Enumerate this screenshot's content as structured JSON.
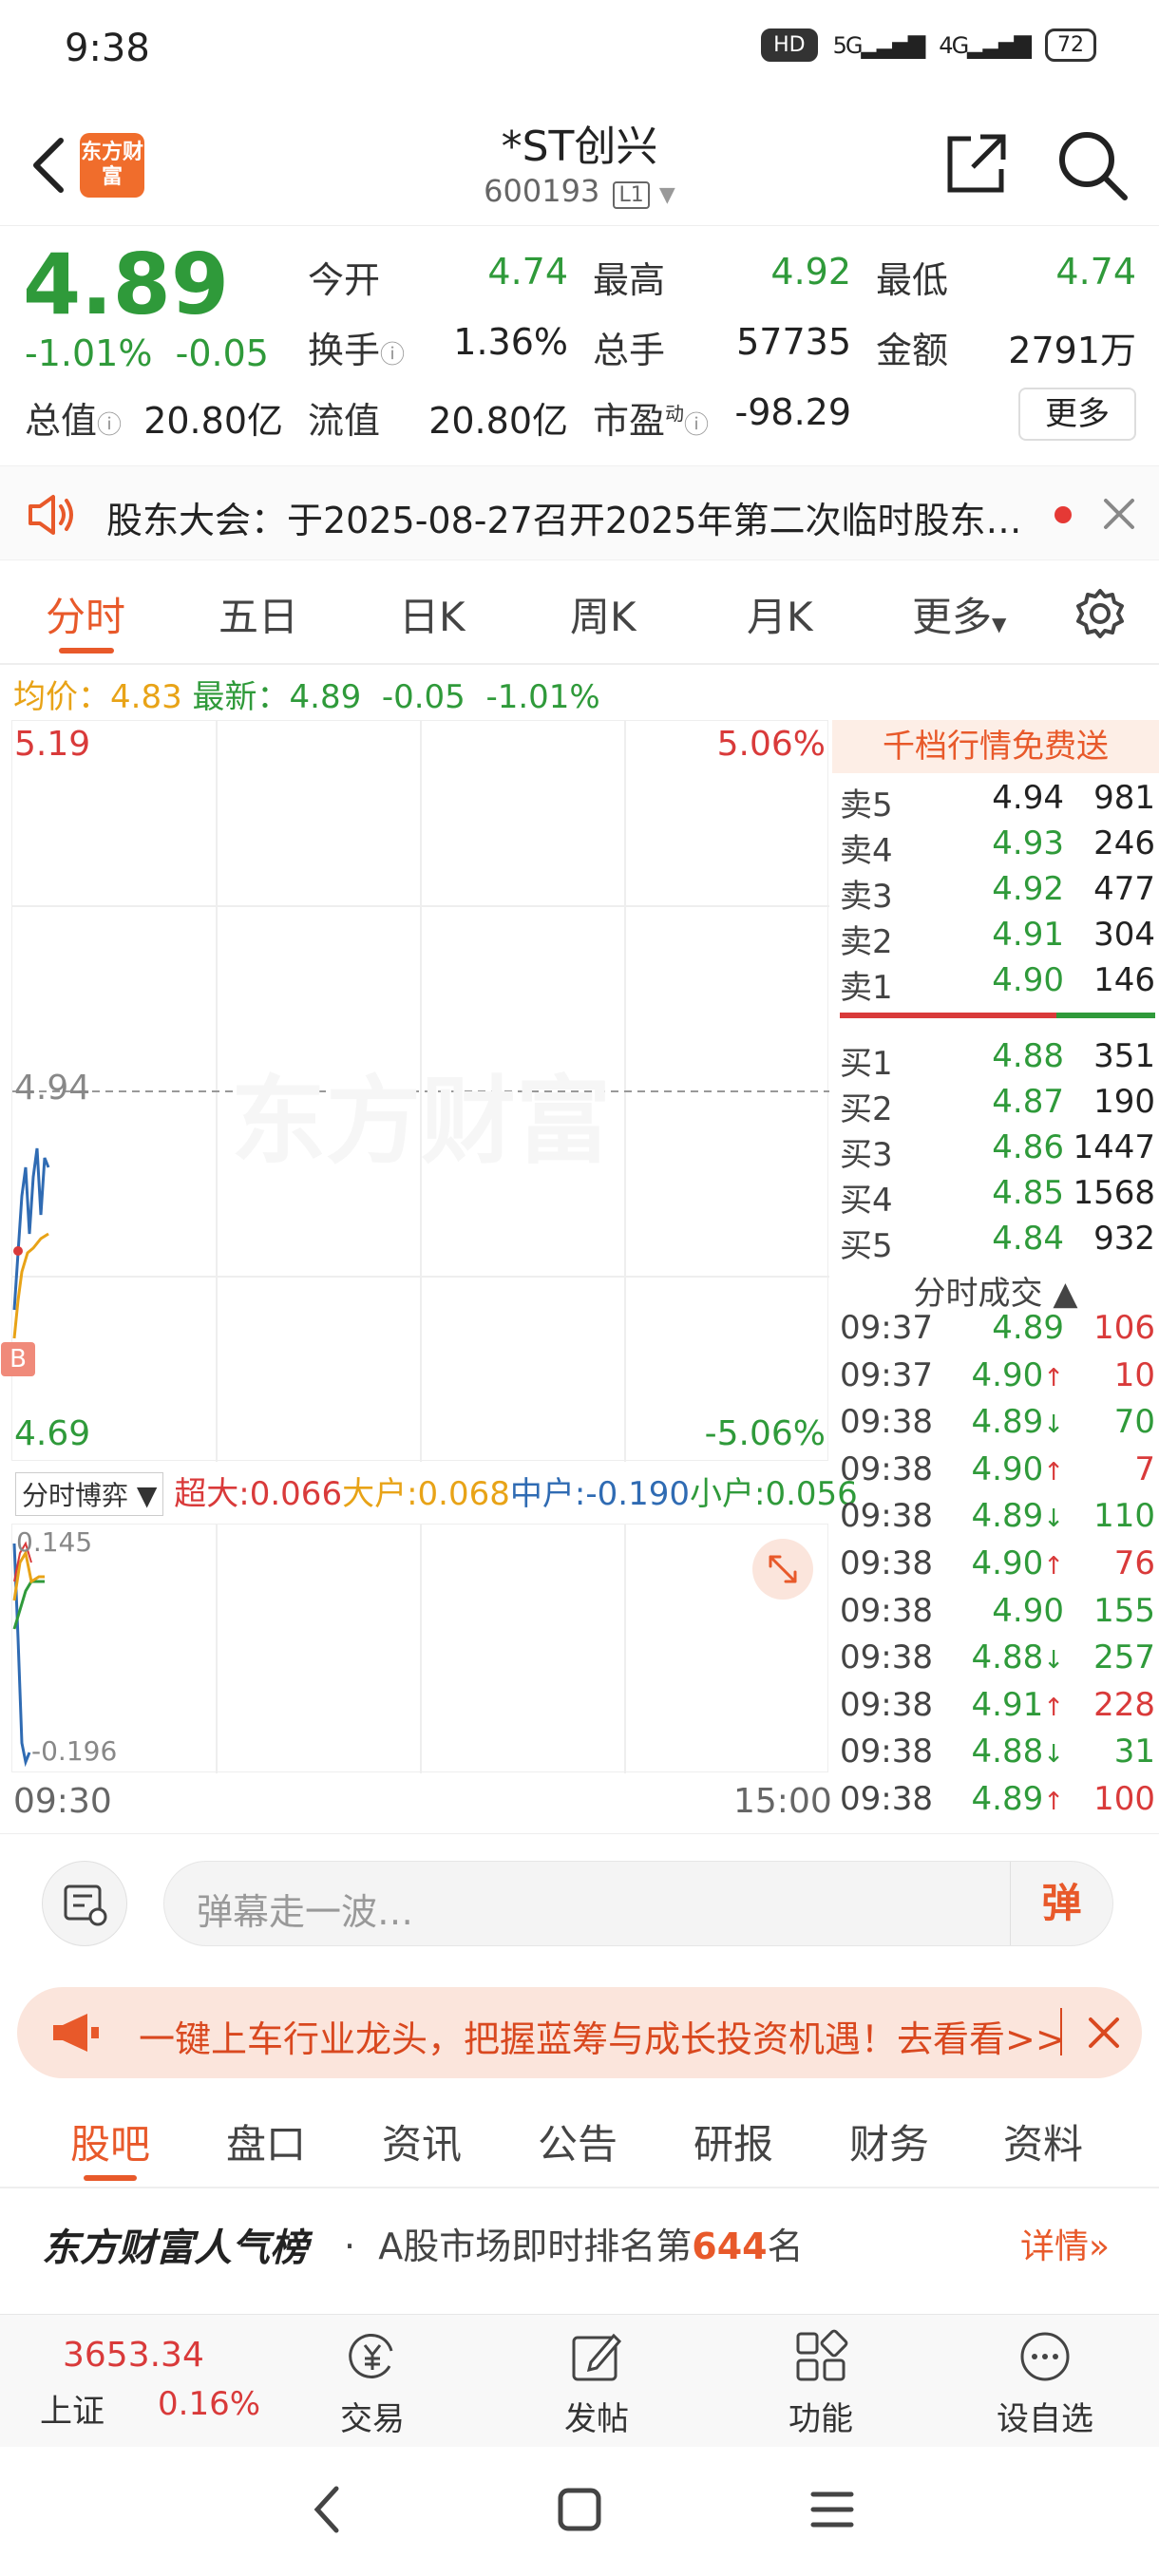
{
  "status_bar": {
    "time": "9:38",
    "hd": "HD",
    "net1": "5G",
    "net2": "4G",
    "battery": "72"
  },
  "header": {
    "logo_text": "东方财富",
    "title": "*ST创兴",
    "code": "600193",
    "level": "L1"
  },
  "quote": {
    "price": "4.89",
    "change_pct": "-1.01%",
    "change_amt": "-0.05",
    "labels": {
      "open": "今开",
      "high": "最高",
      "low": "最低",
      "turnover": "换手",
      "volume": "总手",
      "amount": "金额",
      "mktcap": "总值",
      "float": "流值",
      "pe": "市盈"
    },
    "values": {
      "open": "4.74",
      "high": "4.92",
      "low": "4.74",
      "turnover": "1.36%",
      "volume": "57735",
      "amount": "2791万",
      "mktcap": "20.80亿",
      "float": "20.80亿",
      "pe": "-98.29"
    },
    "pe_mark": "动",
    "more": "更多"
  },
  "notice": {
    "text": "股东大会：于2025-08-27召开2025年第二次临时股东…"
  },
  "chart_tabs": [
    "分时",
    "五日",
    "日K",
    "周K",
    "月K",
    "更多"
  ],
  "avg_line": {
    "avg_label": "均价：",
    "avg": "4.83",
    "last_label": "最新：",
    "last": "4.89",
    "chg": "-0.05",
    "pct": "-1.01%"
  },
  "chart": {
    "top_price": "5.19",
    "top_pct": "5.06%",
    "mid_price": "4.94",
    "bottom_price": "4.69",
    "bottom_pct": "-5.06%",
    "watermark": "东方财富",
    "b_marker": "B",
    "time_start": "09:30",
    "time_end": "15:00"
  },
  "flow": {
    "selector": "分时博弈",
    "items": [
      {
        "label": "超大:",
        "value": "0.066",
        "color": "#d93a3a"
      },
      {
        "label": "大户:",
        "value": "0.068",
        "color": "#e8a317"
      },
      {
        "label": "中户:",
        "value": "-0.190",
        "color": "#2f6bb3"
      },
      {
        "label": "小户:",
        "value": "0.056",
        "color": "#2f9a3a"
      }
    ],
    "sub_top": "0.145",
    "sub_bottom": "-0.196"
  },
  "order_book": {
    "promo": "千档行情免费送",
    "asks": [
      {
        "label": "卖5",
        "price": "4.94",
        "vol": "981",
        "color": "#222"
      },
      {
        "label": "卖4",
        "price": "4.93",
        "vol": "246",
        "color": "#2f9a3a"
      },
      {
        "label": "卖3",
        "price": "4.92",
        "vol": "477",
        "color": "#2f9a3a"
      },
      {
        "label": "卖2",
        "price": "4.91",
        "vol": "304",
        "color": "#2f9a3a"
      },
      {
        "label": "卖1",
        "price": "4.90",
        "vol": "146",
        "color": "#2f9a3a"
      }
    ],
    "bids": [
      {
        "label": "买1",
        "price": "4.88",
        "vol": "351",
        "color": "#2f9a3a"
      },
      {
        "label": "买2",
        "price": "4.87",
        "vol": "190",
        "color": "#2f9a3a"
      },
      {
        "label": "买3",
        "price": "4.86",
        "vol": "1447",
        "color": "#2f9a3a"
      },
      {
        "label": "买4",
        "price": "4.85",
        "vol": "1568",
        "color": "#2f9a3a"
      },
      {
        "label": "买5",
        "price": "4.84",
        "vol": "932",
        "color": "#2f9a3a"
      }
    ],
    "ticks_title": "分时成交",
    "ticks": [
      {
        "time": "09:37",
        "price": "4.89",
        "arrow": "",
        "vol": "106",
        "vcolor": "#d93a3a"
      },
      {
        "time": "09:37",
        "price": "4.90",
        "arrow": "↑",
        "vol": "10",
        "vcolor": "#d93a3a"
      },
      {
        "time": "09:38",
        "price": "4.89",
        "arrow": "↓",
        "vol": "70",
        "vcolor": "#2f9a3a"
      },
      {
        "time": "09:38",
        "price": "4.90",
        "arrow": "↑",
        "vol": "7",
        "vcolor": "#d93a3a"
      },
      {
        "time": "09:38",
        "price": "4.89",
        "arrow": "↓",
        "vol": "110",
        "vcolor": "#2f9a3a"
      },
      {
        "time": "09:38",
        "price": "4.90",
        "arrow": "↑",
        "vol": "76",
        "vcolor": "#d93a3a"
      },
      {
        "time": "09:38",
        "price": "4.90",
        "arrow": "",
        "vol": "155",
        "vcolor": "#2f9a3a"
      },
      {
        "time": "09:38",
        "price": "4.88",
        "arrow": "↓",
        "vol": "257",
        "vcolor": "#2f9a3a"
      },
      {
        "time": "09:38",
        "price": "4.91",
        "arrow": "↑",
        "vol": "228",
        "vcolor": "#d93a3a"
      },
      {
        "time": "09:38",
        "price": "4.88",
        "arrow": "↓",
        "vol": "31",
        "vcolor": "#2f9a3a"
      },
      {
        "time": "09:38",
        "price": "4.89",
        "arrow": "↑",
        "vol": "100",
        "vcolor": "#d93a3a"
      }
    ]
  },
  "comment": {
    "placeholder": "弹幕走一波…",
    "dan_label": "弹"
  },
  "banner": {
    "text": "一键上车行业龙头，把握蓝筹与成长投资机遇！去看看>>"
  },
  "bottom_tabs": [
    "股吧",
    "盘口",
    "资讯",
    "公告",
    "研报",
    "财务",
    "资料"
  ],
  "rank": {
    "brand": "东方财富人气榜",
    "sep": "·",
    "prefix": "A股市场即时排名第",
    "num": "644",
    "suffix": "名",
    "detail": "详情"
  },
  "nav": {
    "index_value": "3653.34",
    "index_name": "上证",
    "index_chg": "0.16%",
    "items": [
      {
        "label": "交易",
        "icon": "yuan-exchange-icon"
      },
      {
        "label": "发帖",
        "icon": "edit-icon"
      },
      {
        "label": "功能",
        "icon": "grid-icon"
      },
      {
        "label": "设自选",
        "icon": "more-dots-icon"
      }
    ]
  },
  "colors": {
    "up": "#d93a3a",
    "down": "#2f9a3a",
    "accent": "#e8592a"
  }
}
